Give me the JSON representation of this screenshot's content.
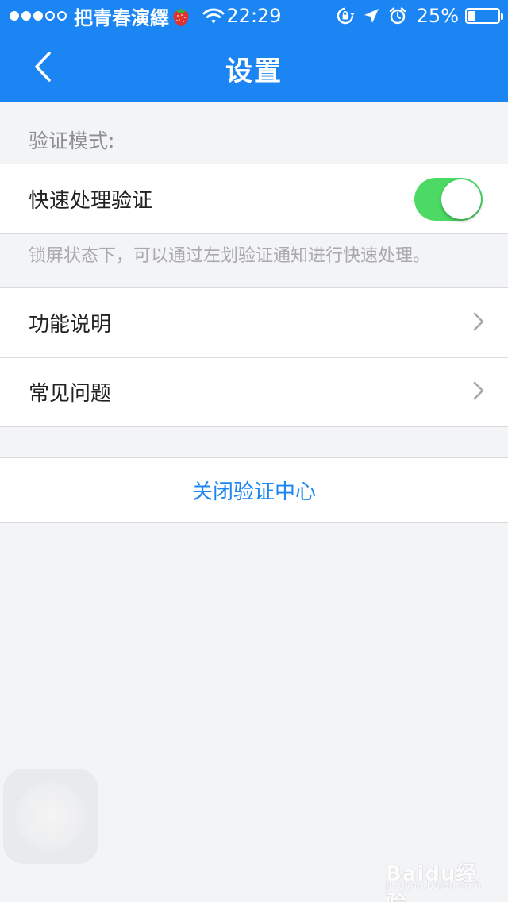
{
  "status_bar": {
    "carrier": "把青春演繹",
    "time": "22:29",
    "battery_percent": "25%",
    "battery_level": 0.25,
    "signal_bars_filled": 3,
    "signal_bars_total": 5,
    "icons": [
      "strawberry-emoji-icon",
      "wifi-icon",
      "orientation-lock-icon",
      "location-arrow-icon",
      "alarm-icon",
      "battery-icon"
    ]
  },
  "nav": {
    "title": "设置",
    "back_icon": "chevron-left-icon"
  },
  "verification_section": {
    "header": "验证模式:",
    "quick_verify": {
      "label": "快速处理验证",
      "enabled": true
    },
    "note": "锁屏状态下，可以通过左划验证通知进行快速处理。"
  },
  "menu": {
    "items": [
      {
        "label": "功能说明",
        "icon": "chevron-right-icon"
      },
      {
        "label": "常见问题",
        "icon": "chevron-right-icon"
      }
    ]
  },
  "actions": {
    "close_center_label": "关闭验证中心"
  },
  "watermark": {
    "text": "Baidu经验",
    "sub": "jingyan.baidu.com"
  },
  "colors": {
    "primary": "#1a85f3",
    "toggle_on": "#4cd964",
    "background": "#f3f4f6"
  }
}
